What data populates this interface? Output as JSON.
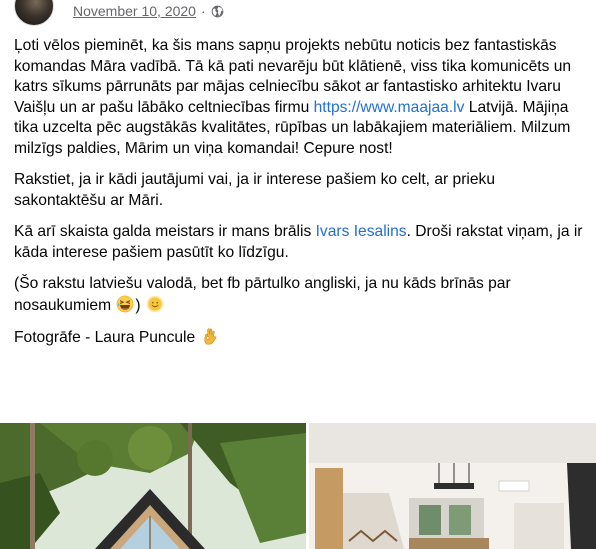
{
  "post": {
    "date": "November 10, 2020",
    "separator": "·",
    "privacy_icon": "globe-icon",
    "p1_a": "Ļoti vēlos pieminēt, ka šis mans sapņu projekts nebūtu noticis bez fantastiskās komandas Māra vadībā.  Tā kā pati nevarēju būt klātienē, viss tika komunicēts un katrs sīkums pārrunāts par mājas celniecību sākot ar fantastisko arhitektu Ivaru Vaišļu un ar pašu lābāko celtniecības firmu ",
    "p1_link": "https://www.maajaa.lv",
    "p1_b": " Latvijā.  Mājiņa tika uzcelta pēc augstākās kvalitātes, rūpības un labākajiem materiāliem. Milzum milzīgs paldies, Mārim un viņa komandai! Cepure nost!",
    "p2": "Rakstiet, ja ir kādi jautājumi vai, ja ir interese pašiem ko celt, ar prieku sakontaktēšu ar Māri.",
    "p3_a": "Kā arī skaista galda meistars ir mans brālis ",
    "p3_link": "Ivars Iesalins",
    "p3_b": ". Droši rakstat viņam, ja ir kāda interese pašiem pasūtīt ko līdzīgu.",
    "p4": "(Šo rakstu latviešu valodā, bet fb pārtulko angliski, ja nu kāds brīnās par nosaukumiem ",
    "p5": "Fotogrāfe - Laura Puncule "
  },
  "colors": {
    "link": "#216fdb",
    "meta": "#65676b",
    "text": "#050505"
  },
  "photos": [
    "a-frame-house-photo",
    "interior-living-room-photo"
  ]
}
